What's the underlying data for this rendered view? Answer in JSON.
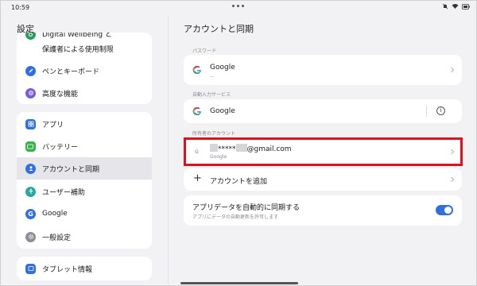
{
  "status_bar": {
    "time": "10:59"
  },
  "sidebar": {
    "title": "設定",
    "group1": [
      {
        "label": "Digital Wellbeing と",
        "icon": "wellbeing-icon"
      },
      {
        "label": "保護者による使用制限",
        "icon": ""
      },
      {
        "label": "ペンとキーボード",
        "icon": "pen-icon"
      },
      {
        "label": "高度な機能",
        "icon": "advanced-icon"
      }
    ],
    "group2": [
      {
        "label": "アプリ",
        "icon": "apps-icon"
      },
      {
        "label": "バッテリー",
        "icon": "battery-icon"
      },
      {
        "label": "アカウントと同期",
        "icon": "account-icon"
      },
      {
        "label": "ユーザー補助",
        "icon": "accessibility-icon"
      },
      {
        "label": "Google",
        "icon": "google-icon"
      },
      {
        "label": "一般設定",
        "icon": "general-settings-icon"
      }
    ],
    "group3": [
      {
        "label": "タブレット情報",
        "icon": "tablet-info-icon"
      }
    ],
    "active_item": "アカウントと同期"
  },
  "main": {
    "title": "アカウントと同期",
    "password_section": {
      "label": "パスワード",
      "item_title": "Google",
      "item_sub": "--"
    },
    "autofill_section": {
      "label": "自動入力サービス",
      "item_title": "Google"
    },
    "owner_section": {
      "label": "所有者のアカウント",
      "account_masked": "*****",
      "account_domain": "@gmail.com",
      "account_sub": "Google"
    },
    "add_account": {
      "label": "アカウントを追加"
    },
    "sync": {
      "title": "アプリデータを自動的に同期する",
      "sub": "アプリにデータの自動更新を許可します",
      "enabled": true
    }
  },
  "colors": {
    "background": "#f2f2f4",
    "card": "#ffffff",
    "active_row": "#e5e5ea",
    "accent_blue": "#2f6fe0",
    "highlight_red": "#e0101b"
  }
}
